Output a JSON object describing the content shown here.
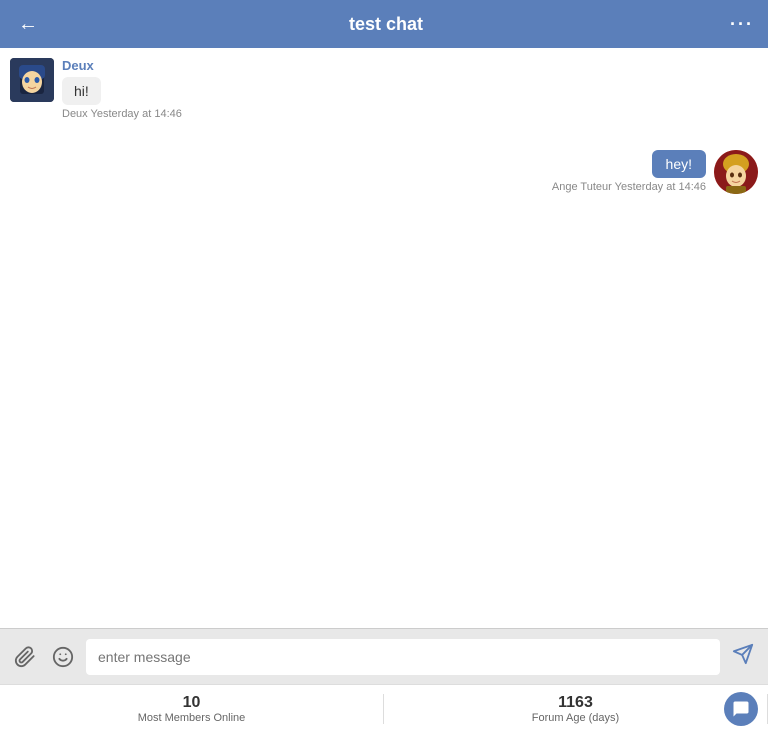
{
  "header": {
    "title": "test chat",
    "back_label": "←",
    "more_label": "···"
  },
  "messages": [
    {
      "id": "msg1",
      "sender": "Deux",
      "text": "hi!",
      "timestamp": "Deux Yesterday at 14:46",
      "side": "left"
    },
    {
      "id": "msg2",
      "sender": "Ange Tuteur",
      "text": "hey!",
      "timestamp": "Ange Tuteur Yesterday at 14:46",
      "side": "right"
    }
  ],
  "input": {
    "placeholder": "enter message"
  },
  "stats": [
    {
      "value": "10",
      "label": "Most Members Online"
    },
    {
      "value": "1163",
      "label": "Forum Age (days)"
    }
  ],
  "colors": {
    "header_bg": "#5b7fba",
    "bubble_right": "#5b7fba"
  }
}
